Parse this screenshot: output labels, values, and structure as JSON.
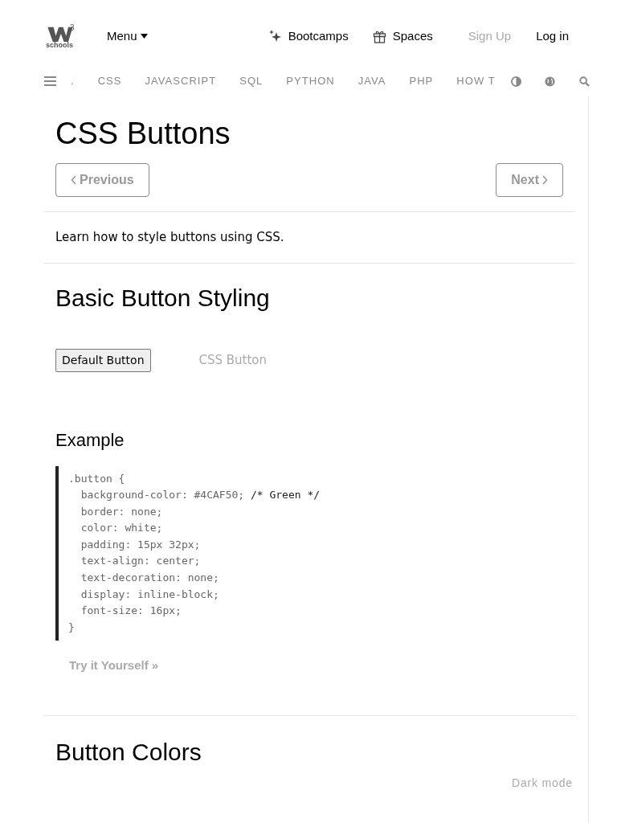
{
  "header": {
    "logo_sup": "3",
    "logo_text": "schools",
    "menu": "Menu",
    "links": [
      {
        "label": "Bootcamps",
        "kind": "sparkle"
      },
      {
        "label": "Spaces",
        "kind": "gift"
      }
    ],
    "sign_up": "Sign Up",
    "log_in": "Log in"
  },
  "nav": {
    "items": [
      ".",
      "CSS",
      "JAVASCRIPT",
      "SQL",
      "PYTHON",
      "JAVA",
      "PHP",
      "HOW T"
    ]
  },
  "page": {
    "title": "CSS Buttons",
    "previous": "Previous",
    "next": "Next",
    "intro": "Learn how to style buttons using CSS.",
    "section_title": "Basic Button Styling",
    "default_button": "Default Button",
    "css_button": "CSS Button",
    "example_title": "Example",
    "code_lines": [
      {
        "text": ".button {"
      },
      {
        "text": "  background-color: #4CAF50; ",
        "comment": "/* Green */"
      },
      {
        "text": "  border: none;"
      },
      {
        "text": "  color: white;"
      },
      {
        "text": "  padding: 15px 32px;"
      },
      {
        "text": "  text-align: center;"
      },
      {
        "text": "  text-decoration: none;"
      },
      {
        "text": "  display: inline-block;"
      },
      {
        "text": "  font-size: 16px;"
      },
      {
        "text": "}"
      }
    ],
    "try_it": "Try it Yourself »",
    "next_section": "Button Colors"
  },
  "dark_mode": "Dark mode"
}
